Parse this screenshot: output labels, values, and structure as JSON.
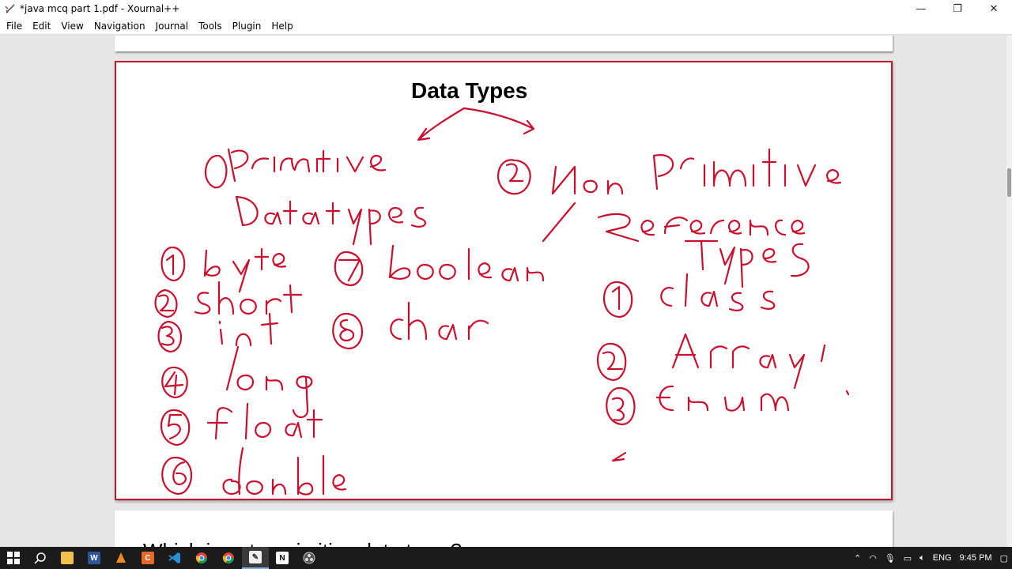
{
  "window": {
    "title": "*java mcq part 1.pdf - Xournal++",
    "minimize": "—",
    "restore": "❐",
    "close": "✕"
  },
  "menu": [
    "File",
    "Edit",
    "View",
    "Navigation",
    "Journal",
    "Tools",
    "Plugin",
    "Help"
  ],
  "page": {
    "heading": "Data Types",
    "next_page_text": "Which is not a primitive data type ?"
  },
  "ink_color": "#c8102e",
  "taskbar": {
    "icons": [
      "windows-start",
      "search",
      "file-explorer",
      "word",
      "vlc",
      "app-orange",
      "vscode",
      "chrome",
      "chrome-2",
      "xournal",
      "notion",
      "obs"
    ],
    "tray": {
      "lang": "ENG",
      "time": "9:45 PM"
    }
  }
}
